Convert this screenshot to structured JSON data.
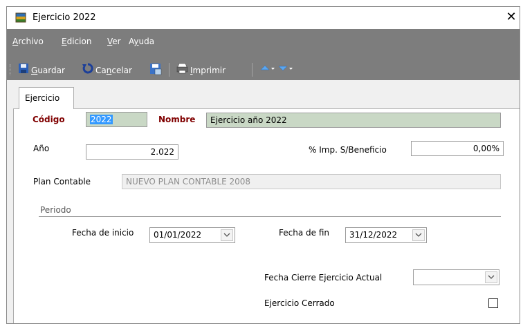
{
  "window": {
    "title": "Ejercicio 2022",
    "close_glyph": "✕"
  },
  "menu": [
    {
      "prefix": "",
      "underline": "A",
      "rest": "rchivo"
    },
    {
      "prefix": "",
      "underline": "E",
      "rest": "dicion"
    },
    {
      "prefix": "",
      "underline": "V",
      "rest": "er"
    },
    {
      "prefix": "A",
      "underline": "y",
      "rest": "uda"
    }
  ],
  "toolbar": {
    "save": {
      "prefix": "",
      "underline": "G",
      "rest": "uardar"
    },
    "cancel": {
      "prefix": "Ca",
      "underline": "n",
      "rest": "celar"
    },
    "print": {
      "prefix": "",
      "underline": "I",
      "rest": "mprimir"
    }
  },
  "tab": {
    "label": "Ejercicio"
  },
  "form": {
    "codigo_label": "Código",
    "codigo_value": "2022",
    "nombre_label": "Nombre",
    "nombre_value": "Ejercicio año 2022",
    "ano_label": "Año",
    "ano_value": "2.022",
    "imp_label": "% Imp. S/Beneficio",
    "imp_value": "0,00%",
    "plan_label": "Plan Contable",
    "plan_value": "NUEVO PLAN CONTABLE 2008",
    "periodo_label": "Periodo",
    "fecha_inicio_label": "Fecha de inicio",
    "fecha_inicio_value": "01/01/2022",
    "fecha_fin_label": "Fecha de fin",
    "fecha_fin_value": "31/12/2022",
    "cierre_label": "Fecha Cierre Ejercicio Actual",
    "cierre_value": "",
    "cerrado_label": "Ejercicio Cerrado",
    "cerrado_checked": false
  },
  "colors": {
    "menubar_bg": "#7d7d7d",
    "field_green": "#c9d8c5",
    "label_red": "#800000",
    "selection": "#3399ff"
  }
}
